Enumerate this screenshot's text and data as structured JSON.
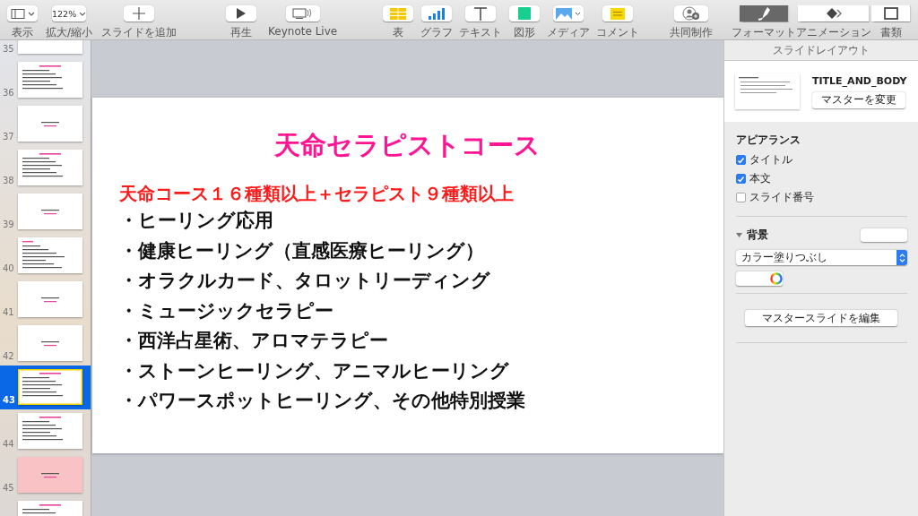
{
  "toolbar": {
    "items": [
      {
        "kind": "view",
        "label": "表示"
      },
      {
        "kind": "zoom",
        "value": "122%",
        "label": "拡大/縮小"
      },
      {
        "kind": "add",
        "label": "スライドを追加"
      },
      {
        "kind": "play",
        "label": "再生"
      },
      {
        "kind": "live",
        "label": "Keynote Live"
      },
      {
        "kind": "table",
        "label": "表"
      },
      {
        "kind": "chart",
        "label": "グラフ"
      },
      {
        "kind": "text",
        "label": "テキスト"
      },
      {
        "kind": "shape",
        "label": "図形"
      },
      {
        "kind": "media",
        "label": "メディア"
      },
      {
        "kind": "comment",
        "label": "コメント"
      },
      {
        "kind": "collab",
        "label": "共同制作"
      }
    ],
    "inspector_tabs": [
      {
        "kind": "format",
        "label": "フォーマット",
        "selected": true
      },
      {
        "kind": "animation",
        "label": "アニメーション",
        "selected": false
      },
      {
        "kind": "document",
        "label": "書類",
        "selected": false
      }
    ]
  },
  "sidebar": {
    "slides": [
      {
        "number": "35",
        "kind": "blank",
        "color": "#ffffff",
        "selected": false
      },
      {
        "number": "36",
        "kind": "title_body",
        "color": "#ffffff",
        "selected": false
      },
      {
        "number": "37",
        "kind": "center",
        "color": "#ffffff",
        "selected": false
      },
      {
        "number": "38",
        "kind": "title_body",
        "color": "#ffffff",
        "selected": false
      },
      {
        "number": "39",
        "kind": "center",
        "color": "#ffffff",
        "selected": false
      },
      {
        "number": "40",
        "kind": "body",
        "color": "#ffffff",
        "selected": false
      },
      {
        "number": "41",
        "kind": "center",
        "color": "#ffffff",
        "selected": false
      },
      {
        "number": "42",
        "kind": "center",
        "color": "#ffffff",
        "selected": false
      },
      {
        "number": "43",
        "kind": "title_body",
        "color": "#ffffff",
        "selected": true
      },
      {
        "number": "44",
        "kind": "title_body",
        "color": "#ffffff",
        "selected": false
      },
      {
        "number": "45",
        "kind": "center",
        "color": "#f9c3c6",
        "selected": false
      },
      {
        "kind": "title_body",
        "color": "#ffffff",
        "selected": false
      }
    ]
  },
  "slide": {
    "title": "天命セラピストコース",
    "subtitle": "天命コース１６種類以上＋セラピスト９種類以上",
    "bullets": [
      "・ヒーリング応用",
      "・健康ヒーリング（直感医療ヒーリング）",
      "・オラクルカード、タロットリーディング",
      "・ミュージックセラピー",
      "・西洋占星術、アロマテラピー",
      "・ストーンヒーリング、アニマルヒーリング",
      "・パワースポットヒーリング、その他特別授業"
    ]
  },
  "inspector": {
    "header": "スライドレイアウト",
    "master": {
      "name": "TITLE_AND_BODY",
      "button": "マスターを変更"
    },
    "appearance": {
      "heading": "アピアランス",
      "options": [
        {
          "label": "タイトル",
          "checked": true
        },
        {
          "label": "本文",
          "checked": true
        },
        {
          "label": "スライド番号",
          "checked": false
        }
      ]
    },
    "background": {
      "label": "背景",
      "expanded": true,
      "fill": "カラー塗りつぶし"
    },
    "edit_button": "マスタースライドを編集"
  }
}
